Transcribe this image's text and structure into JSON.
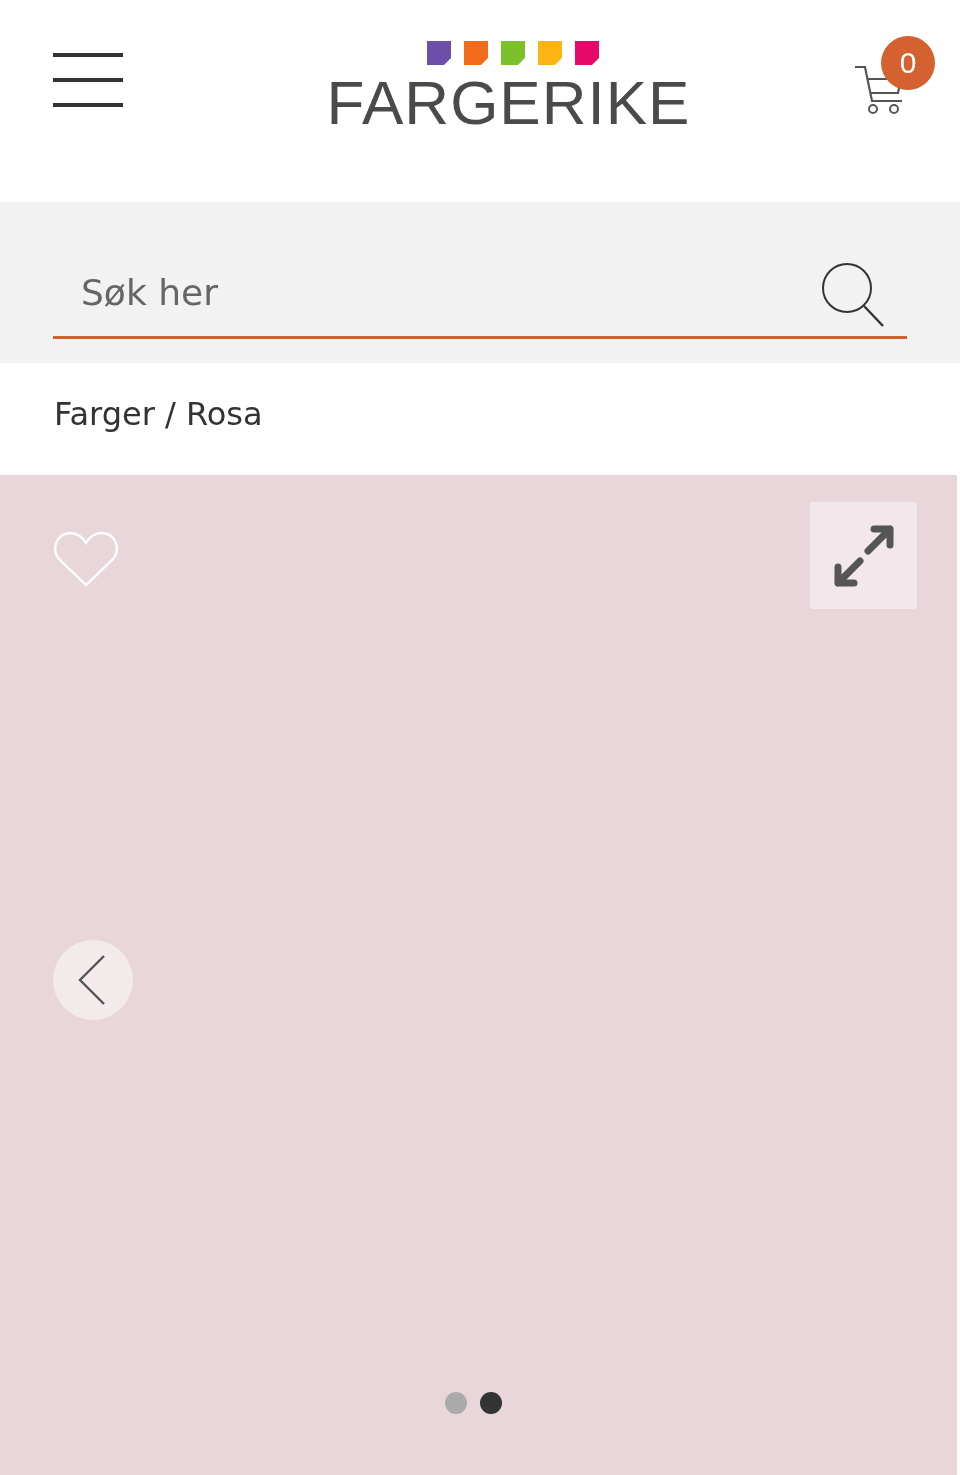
{
  "header": {
    "logo": {
      "squares": [
        {
          "color": "#6b4fa8"
        },
        {
          "color": "#f26a1b"
        },
        {
          "color": "#7cc12b"
        },
        {
          "color": "#fdb515"
        },
        {
          "color": "#e5096b"
        }
      ],
      "text": "FARGERIKE"
    },
    "cart_count": "0"
  },
  "search": {
    "placeholder": "Søk her"
  },
  "breadcrumb": "Farger / Rosa",
  "gallery": {
    "favorite": false,
    "dots": [
      {
        "selected": false
      },
      {
        "selected": true
      }
    ]
  }
}
